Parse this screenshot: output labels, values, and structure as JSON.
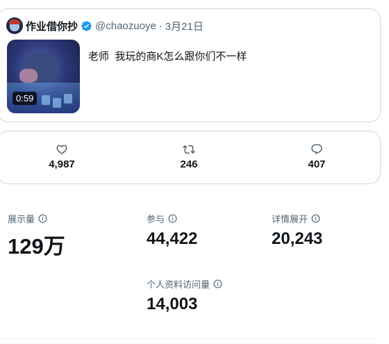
{
  "tweet": {
    "display_name": "作业借你抄",
    "handle": "@chaozuoye",
    "separator": "·",
    "date": "3月21日",
    "text": "老师  我玩的商K怎么跟你们不一样",
    "video_duration": "0:59",
    "icons": {
      "avatar": "user-avatar",
      "verified": "verified-badge-icon",
      "video": "video-thumbnail"
    }
  },
  "engagement": [
    {
      "icon": "like-icon",
      "value": "4,987"
    },
    {
      "icon": "retweet-icon",
      "value": "246"
    },
    {
      "icon": "reply-icon",
      "value": "407"
    }
  ],
  "stats": {
    "impressions": {
      "label": "展示量",
      "value": "129万"
    },
    "engagements": {
      "label": "参与",
      "value": "44,422"
    },
    "detail_expands": {
      "label": "详情展开",
      "value": "20,243"
    },
    "profile_visits": {
      "label": "个人资料访问量",
      "value": "14,003"
    }
  },
  "colors": {
    "accent": "#1d9bf0",
    "text": "#0f1419",
    "secondary": "#536471",
    "border": "#cfd9de"
  }
}
